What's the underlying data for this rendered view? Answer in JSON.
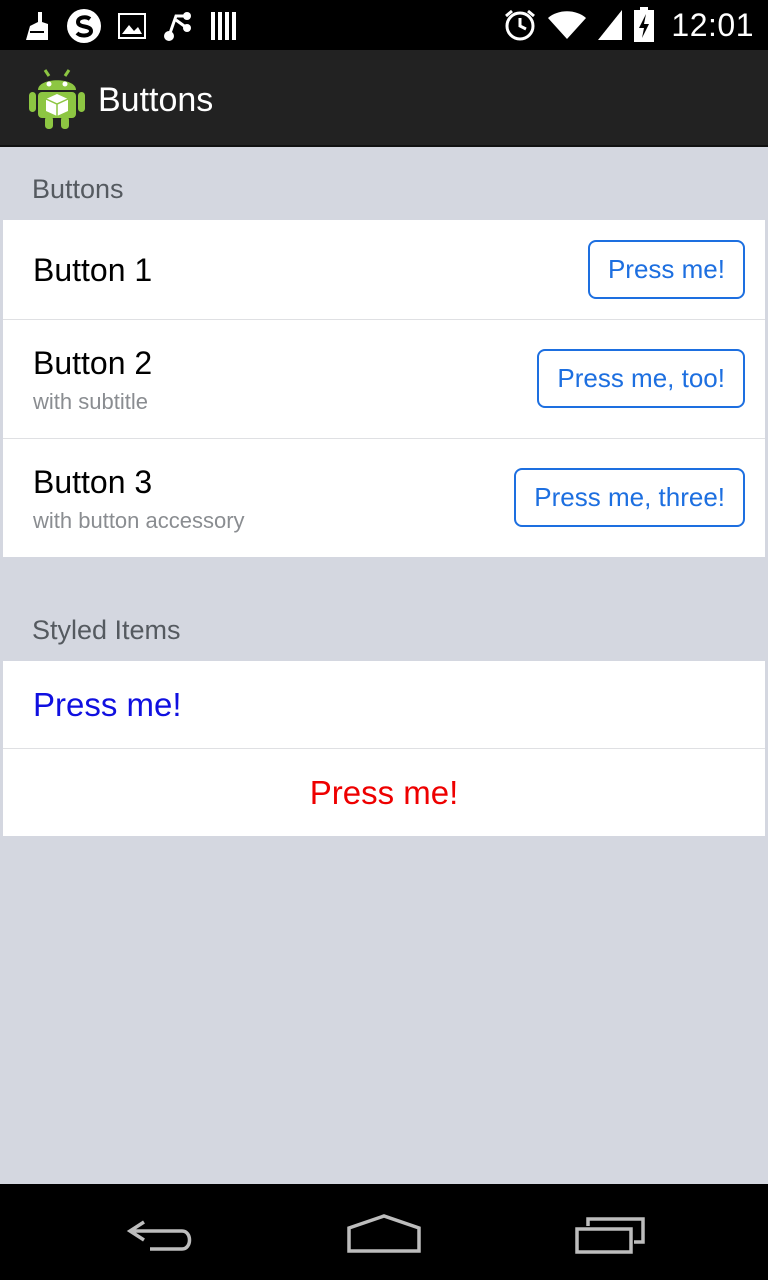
{
  "status_bar": {
    "time": "12:01",
    "left_icons": [
      "cleaner-icon",
      "skype-icon",
      "picture-icon",
      "share-icon",
      "barcode-icon"
    ],
    "right_icons": [
      "alarm-icon",
      "wifi-icon",
      "signal-icon",
      "battery-charging-icon"
    ]
  },
  "action_bar": {
    "title": "Buttons",
    "icon": "android-app-icon"
  },
  "sections": {
    "buttons": {
      "header": "Buttons",
      "rows": [
        {
          "title": "Button 1",
          "subtitle": "",
          "button": "Press me!"
        },
        {
          "title": "Button 2",
          "subtitle": "with subtitle",
          "button": "Press me, too!"
        },
        {
          "title": "Button 3",
          "subtitle": "with button accessory",
          "button": "Press me, three!"
        }
      ]
    },
    "styled": {
      "header": "Styled Items",
      "left_item": "Press me!",
      "center_item": "Press me!",
      "left_color": "#1010e0",
      "center_color": "#ee0000"
    }
  },
  "nav_bar": {
    "icons": [
      "back-icon",
      "home-icon",
      "recent-apps-icon"
    ]
  },
  "colors": {
    "background": "#d4d7e0",
    "accent_blue": "#1d6fe0",
    "action_bar": "#222222"
  }
}
